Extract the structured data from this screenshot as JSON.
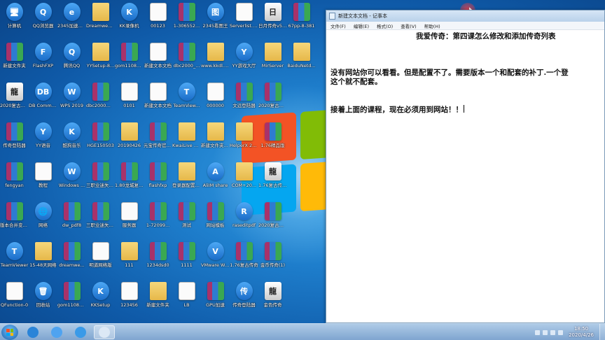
{
  "desktop": {
    "icons": [
      {
        "label": "计算机",
        "type": "app",
        "glyph": "🖥"
      },
      {
        "label": "QQ浏览器",
        "type": "app",
        "glyph": "Q"
      },
      {
        "label": "2345加速浏览器",
        "type": "app",
        "glyph": "e"
      },
      {
        "label": "Dreamweaver 8 简体中文...",
        "type": "folder",
        "glyph": ""
      },
      {
        "label": "KK录像机",
        "type": "app",
        "glyph": "K"
      },
      {
        "label": "00123",
        "type": "doc",
        "glyph": ""
      },
      {
        "label": "1-306552...",
        "type": "rar",
        "glyph": ""
      },
      {
        "label": "2345看图王",
        "type": "app",
        "glyph": "图"
      },
      {
        "label": "Serverlist.txt",
        "type": "doc",
        "glyph": ""
      },
      {
        "label": "日月传奇v5.6[驾驶]",
        "type": "game",
        "glyph": "日"
      },
      {
        "label": "67pp-8-381",
        "type": "rar",
        "glyph": ""
      },
      {
        "label": "新建文件夹",
        "type": "rar",
        "glyph": ""
      },
      {
        "label": "FlashFXP",
        "type": "app",
        "glyph": "F"
      },
      {
        "label": "腾讯QQ",
        "type": "app",
        "glyph": "Q"
      },
      {
        "label": "YYSetup-8...",
        "type": "folder",
        "glyph": ""
      },
      {
        "label": "gom1108引擎包(1)",
        "type": "rar",
        "glyph": ""
      },
      {
        "label": "新建文本文档",
        "type": "doc",
        "glyph": ""
      },
      {
        "label": "dbc2000_...",
        "type": "rar",
        "glyph": ""
      },
      {
        "label": "www.kkdl.q...",
        "type": "folder",
        "glyph": ""
      },
      {
        "label": "YY游戏大厅",
        "type": "app",
        "glyph": "Y"
      },
      {
        "label": "MirServer",
        "type": "folder",
        "glyph": ""
      },
      {
        "label": "BaiduNetd...",
        "type": "folder",
        "glyph": ""
      },
      {
        "label": "2020复古雷霆【微端】",
        "type": "game",
        "glyph": "龍"
      },
      {
        "label": "DB Command...",
        "type": "app",
        "glyph": "DB"
      },
      {
        "label": "WPS 2019",
        "type": "app",
        "glyph": "W"
      },
      {
        "label": "dbc2000中文汉化版",
        "type": "rar",
        "glyph": ""
      },
      {
        "label": "0101",
        "type": "doc",
        "glyph": ""
      },
      {
        "label": "新建文本文档",
        "type": "doc",
        "glyph": ""
      },
      {
        "label": "TeamView...",
        "type": "app",
        "glyph": "T"
      },
      {
        "label": "000000",
        "type": "doc",
        "glyph": ""
      },
      {
        "label": "文远登陆器",
        "type": "rar",
        "glyph": ""
      },
      {
        "label": "2020复古雷霆【微端】",
        "type": "rar",
        "glyph": ""
      },
      {
        "label": "",
        "type": "none",
        "glyph": ""
      },
      {
        "label": "传奇登陆器",
        "type": "rar",
        "glyph": ""
      },
      {
        "label": "YY语音",
        "type": "app",
        "glyph": "Y"
      },
      {
        "label": "酷狗音乐",
        "type": "app",
        "glyph": "K"
      },
      {
        "label": "HGE150503",
        "type": "rar",
        "glyph": ""
      },
      {
        "label": "20190426",
        "type": "folder",
        "glyph": ""
      },
      {
        "label": "元宝传奇官方网站文件",
        "type": "rar",
        "glyph": ""
      },
      {
        "label": "KwaiLive S...",
        "type": "folder",
        "glyph": ""
      },
      {
        "label": "新建文件夹(3)",
        "type": "folder",
        "glyph": ""
      },
      {
        "label": "HelperX 2345",
        "type": "folder",
        "glyph": ""
      },
      {
        "label": "1.76精品版",
        "type": "rar",
        "glyph": ""
      },
      {
        "label": "",
        "type": "none",
        "glyph": ""
      },
      {
        "label": "fengyan",
        "type": "rar",
        "glyph": ""
      },
      {
        "label": "教程",
        "type": "doc",
        "glyph": ""
      },
      {
        "label": "Windows ...",
        "type": "app",
        "glyph": "W"
      },
      {
        "label": "三职业迷失版本...",
        "type": "rar",
        "glyph": ""
      },
      {
        "label": "1.80龙城复古传奇...",
        "type": "rar",
        "glyph": ""
      },
      {
        "label": "flashfxp",
        "type": "rar",
        "glyph": ""
      },
      {
        "label": "登录器配置器 V1.4",
        "type": "folder",
        "glyph": ""
      },
      {
        "label": "AliIM share",
        "type": "app",
        "glyph": "A"
      },
      {
        "label": "COM+20...",
        "type": "folder",
        "glyph": ""
      },
      {
        "label": "1.76复古传奇...",
        "type": "game",
        "glyph": "龍"
      },
      {
        "label": "",
        "type": "none",
        "glyph": ""
      },
      {
        "label": "版本合并变量表查",
        "type": "rar",
        "glyph": ""
      },
      {
        "label": "网络",
        "type": "app",
        "glyph": "🌐"
      },
      {
        "label": "dw_pdf8",
        "type": "rar",
        "glyph": ""
      },
      {
        "label": "三职业迷失(1-4)",
        "type": "rar",
        "glyph": ""
      },
      {
        "label": "服务器",
        "type": "doc",
        "glyph": ""
      },
      {
        "label": "1-72099...",
        "type": "rar",
        "glyph": ""
      },
      {
        "label": "测试",
        "type": "rar",
        "glyph": ""
      },
      {
        "label": "网站模板",
        "type": "rar",
        "glyph": ""
      },
      {
        "label": "raseditpdf",
        "type": "app",
        "glyph": "R"
      },
      {
        "label": "2020复古雷霆【微端】",
        "type": "rar",
        "glyph": ""
      },
      {
        "label": "",
        "type": "none",
        "glyph": ""
      },
      {
        "label": "TeamViewer",
        "type": "app",
        "glyph": "T"
      },
      {
        "label": "15-48天网络",
        "type": "folder",
        "glyph": ""
      },
      {
        "label": "dreamwe...",
        "type": "rar",
        "glyph": ""
      },
      {
        "label": "明道网络版",
        "type": "doc",
        "glyph": ""
      },
      {
        "label": "111",
        "type": "folder",
        "glyph": ""
      },
      {
        "label": "1234dsd0",
        "type": "rar",
        "glyph": ""
      },
      {
        "label": "1111",
        "type": "rar",
        "glyph": ""
      },
      {
        "label": "VMware Workstation",
        "type": "app",
        "glyph": "V"
      },
      {
        "label": "1.76复古传奇",
        "type": "rar",
        "glyph": ""
      },
      {
        "label": "金币传奇(1)",
        "type": "rar",
        "glyph": ""
      },
      {
        "label": "",
        "type": "none",
        "glyph": ""
      },
      {
        "label": "QFunction-0",
        "type": "doc",
        "glyph": ""
      },
      {
        "label": "回收站",
        "type": "app",
        "glyph": "🗑"
      },
      {
        "label": "gom1108引擎包",
        "type": "rar",
        "glyph": ""
      },
      {
        "label": "KKSetup",
        "type": "app",
        "glyph": "K"
      },
      {
        "label": "123456",
        "type": "doc",
        "glyph": ""
      },
      {
        "label": "新建文件夹",
        "type": "folder",
        "glyph": ""
      },
      {
        "label": "LB",
        "type": "doc",
        "glyph": ""
      },
      {
        "label": "GPU加速",
        "type": "rar",
        "glyph": ""
      },
      {
        "label": "传奇登陆器",
        "type": "app",
        "glyph": "传"
      },
      {
        "label": "金色传奇",
        "type": "game",
        "glyph": "龍"
      },
      {
        "label": "",
        "type": "none",
        "glyph": ""
      }
    ]
  },
  "notepad": {
    "title": "新建文本文档 - 记事本",
    "menu": [
      "文件(F)",
      "编辑(E)",
      "格式(O)",
      "查看(V)",
      "帮助(H)"
    ],
    "lines": [
      {
        "text": "我爱传奇：第四课怎么修改和添加传奇列表",
        "style": "heading"
      },
      {
        "text": "",
        "style": "blank"
      },
      {
        "text": "",
        "style": "blank"
      },
      {
        "text": "",
        "style": "blank"
      },
      {
        "text": "  没有网站你可以看看。但是配置不了。需要版本一个和配套的补丁.一个登",
        "style": "bold"
      },
      {
        "text": "这个就不配套。",
        "style": "bold"
      },
      {
        "text": "",
        "style": "blank"
      },
      {
        "text": "",
        "style": "blank"
      },
      {
        "text": "接着上面的课程，现在必须用到网站！！",
        "style": "bold"
      }
    ]
  },
  "taskbar": {
    "items": [
      {
        "name": "internet-explorer",
        "color": "#2a84d8"
      },
      {
        "name": "baidu-netdisk",
        "color": "#4fa3f0"
      },
      {
        "name": "qq-browser",
        "color": "#3a9ae8"
      },
      {
        "name": "notepad",
        "color": "#dce8f5"
      }
    ],
    "clock_time": "18:50",
    "clock_date": "2020/4/26"
  },
  "colors": {
    "wallpaper": "#1e7ecc",
    "taskbar": "#8fb4dc"
  }
}
